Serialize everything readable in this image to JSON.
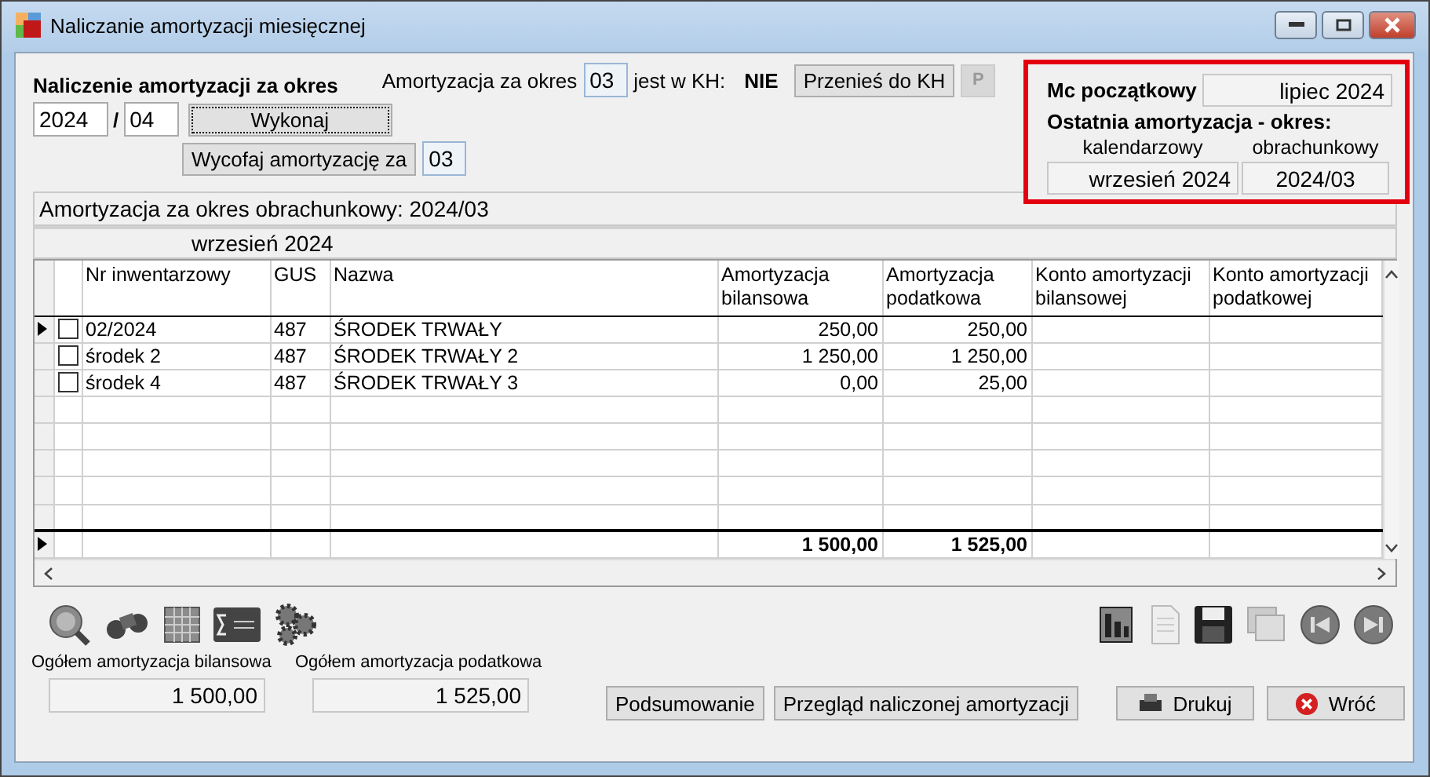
{
  "window": {
    "title": "Naliczanie amortyzacji miesięcznej"
  },
  "period": {
    "heading": "Naliczenie amortyzacji za okres",
    "year": "2024",
    "month": "04",
    "separator": "/",
    "execute_button": "Wykonaj",
    "withdraw_button": "Wycofaj  amortyzację za",
    "withdraw_value": "03"
  },
  "kh": {
    "label": "Amortyzacja za okres",
    "period_value": "03",
    "suffix": "jest w KH:",
    "status": "NIE",
    "transfer_button": "Przenieś do KH",
    "p_button": {
      "label": "P",
      "disabled": true
    }
  },
  "panel": {
    "start_label": "Mc początkowy",
    "start_value": "lipiec 2024",
    "last_label": "Ostatnia amortyzacja - okres:",
    "calendar_label": "kalendarzowy",
    "fiscal_label": "obrachunkowy",
    "calendar_value": "wrzesień 2024",
    "fiscal_value": "2024/03",
    "highlighted": true
  },
  "grid": {
    "title": "Amortyzacja za okres obrachunkowy: 2024/03",
    "subheading": "wrzesień 2024",
    "columns": [
      "Nr inwentarzowy",
      "GUS",
      "Nazwa",
      "Amortyzacja bilansowa",
      "Amortyzacja podatkowa",
      "Konto amortyzacji bilansowej",
      "Konto amortyzacji podatkowej"
    ],
    "rows": [
      {
        "nr": "02/2024",
        "gus": "487",
        "name": "ŚRODEK TRWAŁY",
        "bil": "250,00",
        "pod": "250,00",
        "checked": false,
        "current": true
      },
      {
        "nr": "środek 2",
        "gus": "487",
        "name": "ŚRODEK TRWAŁY 2",
        "bil": "1 250,00",
        "pod": "1 250,00",
        "checked": false,
        "current": false
      },
      {
        "nr": "środek 4",
        "gus": "487",
        "name": "ŚRODEK TRWAŁY 3",
        "bil": "0,00",
        "pod": "25,00",
        "checked": false,
        "current": false
      }
    ],
    "totals": {
      "bil": "1 500,00",
      "pod": "1 525,00"
    }
  },
  "summary": [
    {
      "label": "Ogółem amortyzacja bilansowa",
      "value": "1 500,00"
    },
    {
      "label": "Ogółem amortyzacja podatkowa",
      "value": "1 525,00"
    }
  ],
  "buttons": [
    {
      "label": "Podsumowanie",
      "kind": "plain"
    },
    {
      "label": "Przegląd naliczonej amortyzacji",
      "kind": "plain"
    },
    {
      "label": "Drukuj",
      "kind": "print"
    },
    {
      "label": "Wróć",
      "kind": "close"
    }
  ]
}
